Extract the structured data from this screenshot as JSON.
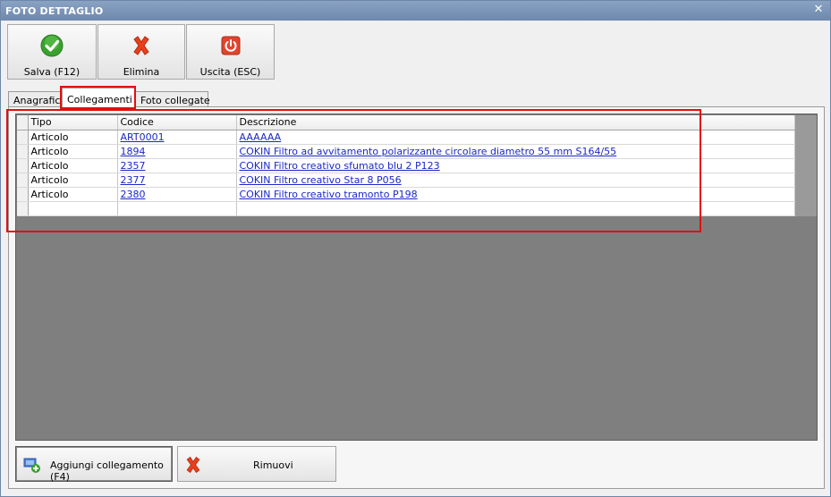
{
  "window": {
    "title": "FOTO DETTAGLIO",
    "close_glyph": "✕"
  },
  "toolbar": {
    "save_label": "Salva (F12)",
    "delete_label": "Elimina",
    "exit_label": "Uscita (ESC)",
    "save_icon": "check-icon",
    "delete_icon": "x-icon",
    "exit_icon": "power-icon"
  },
  "tabs": [
    {
      "label": "Anagrafica"
    },
    {
      "label": "Collegamenti",
      "active": true
    },
    {
      "label": "Foto collegate"
    }
  ],
  "grid": {
    "columns": [
      "Tipo",
      "Codice",
      "Descrizione"
    ],
    "rows": [
      {
        "tipo": "Articolo",
        "codice": "ART0001",
        "descrizione": "AAAAAA"
      },
      {
        "tipo": "Articolo",
        "codice": "1894",
        "descrizione": "COKIN Filtro ad avvitamento polarizzante circolare diametro 55 mm S164/55"
      },
      {
        "tipo": "Articolo",
        "codice": "2357",
        "descrizione": "COKIN Filtro creativo sfumato blu 2 P123"
      },
      {
        "tipo": "Articolo",
        "codice": "2377",
        "descrizione": "COKIN Filtro creativo Star 8 P056"
      },
      {
        "tipo": "Articolo",
        "codice": "2380",
        "descrizione": "COKIN Filtro creativo tramonto P198"
      }
    ]
  },
  "bottom": {
    "add_label": "Aggiungi collegamento (F4)",
    "remove_label": "Rimuovi",
    "add_icon": "add-link-icon",
    "remove_icon": "x-icon"
  },
  "colors": {
    "title_bar": "#7b94b8",
    "highlight": "#e01010",
    "link": "#1a28c8",
    "grid_bg": "#7f7f7f"
  }
}
